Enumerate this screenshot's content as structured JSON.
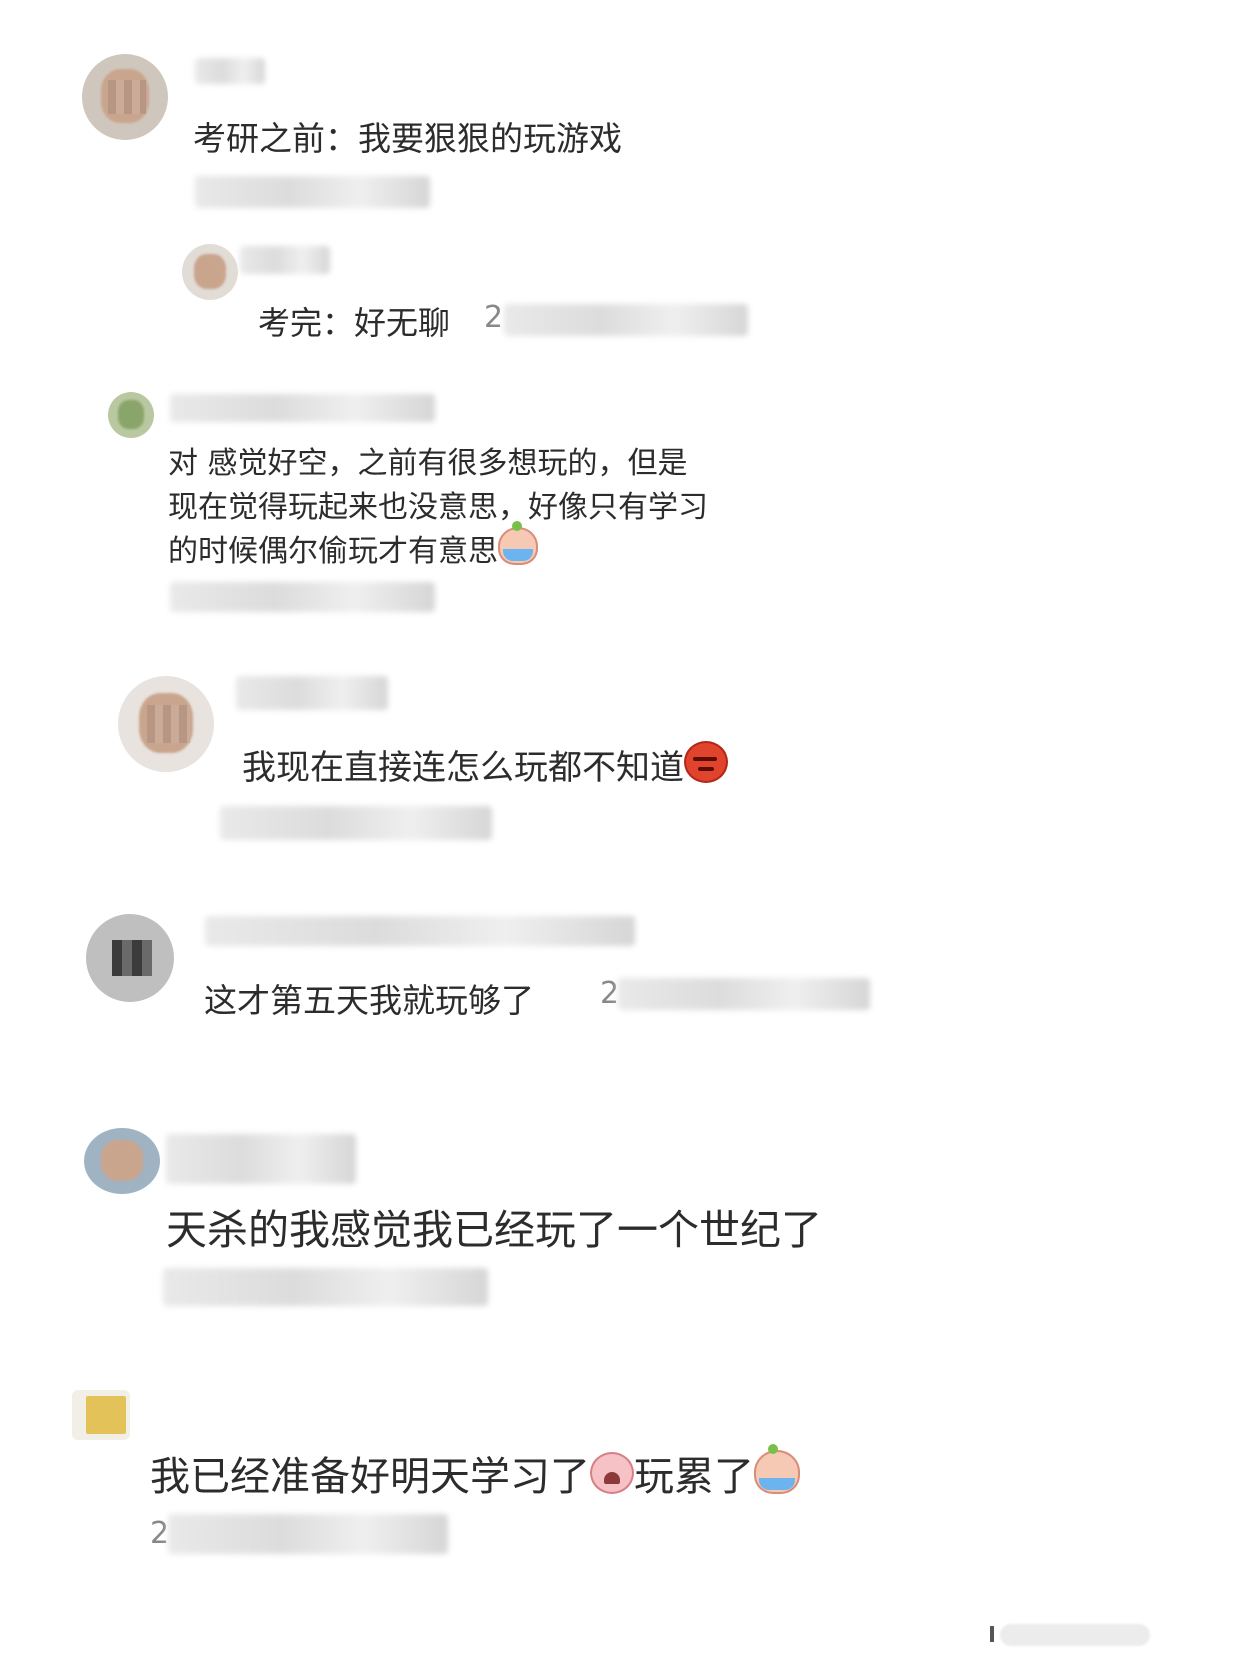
{
  "comments": [
    {
      "text": "考研之前：我要狠狠的玩游戏"
    },
    {
      "text": "考完：好无聊",
      "timestamp_fragment": "2"
    },
    {
      "line1": "对 感觉好空，之前有很多想玩的，但是",
      "line2": "现在觉得玩起来也没意思，好像只有学习",
      "line3": "的时候偶尔偷玩才有意思",
      "emoji": "crying-emoji"
    },
    {
      "text": "我现在直接连怎么玩都不知道",
      "emoji": "devil-emoji"
    },
    {
      "text": "这才第五天我就玩够了",
      "timestamp_fragment": "2"
    },
    {
      "text": "天杀的我感觉我已经玩了一个世纪了"
    },
    {
      "text_part1": "我已经准备好明天学习了",
      "text_part2": "玩累了",
      "emoji1": "sad-emoji",
      "emoji2": "crying-emoji",
      "timestamp_fragment": "2"
    }
  ]
}
